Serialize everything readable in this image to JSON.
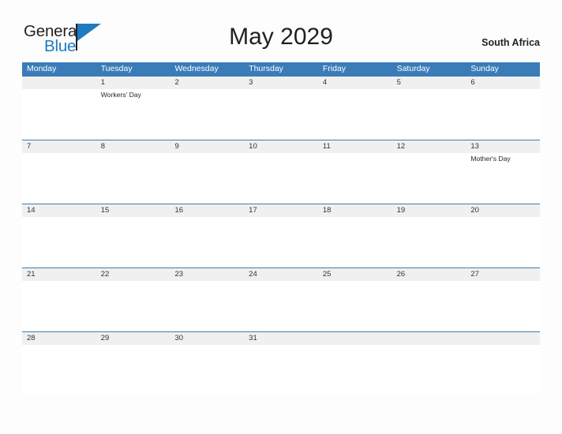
{
  "brand": {
    "name_part1": "General",
    "name_part2": "Blue"
  },
  "header": {
    "title": "May 2029",
    "country": "South Africa"
  },
  "calendar": {
    "weekdays": [
      "Monday",
      "Tuesday",
      "Wednesday",
      "Thursday",
      "Friday",
      "Saturday",
      "Sunday"
    ],
    "colors": {
      "header_blue": "#3a7cb8",
      "date_band_gray": "#f0f0f0",
      "brand_blue": "#1f7ac0",
      "page_background": "#fdfdfd",
      "text": "#231f20"
    },
    "weeks": [
      {
        "dates": [
          "",
          "1",
          "2",
          "3",
          "4",
          "5",
          "6"
        ],
        "events": [
          "",
          "Workers' Day",
          "",
          "",
          "",
          "",
          ""
        ]
      },
      {
        "dates": [
          "7",
          "8",
          "9",
          "10",
          "11",
          "12",
          "13"
        ],
        "events": [
          "",
          "",
          "",
          "",
          "",
          "",
          "Mother's Day"
        ]
      },
      {
        "dates": [
          "14",
          "15",
          "16",
          "17",
          "18",
          "19",
          "20"
        ],
        "events": [
          "",
          "",
          "",
          "",
          "",
          "",
          ""
        ]
      },
      {
        "dates": [
          "21",
          "22",
          "23",
          "24",
          "25",
          "26",
          "27"
        ],
        "events": [
          "",
          "",
          "",
          "",
          "",
          "",
          ""
        ]
      },
      {
        "dates": [
          "28",
          "29",
          "30",
          "31",
          "",
          "",
          ""
        ],
        "events": [
          "",
          "",
          "",
          "",
          "",
          "",
          ""
        ]
      }
    ]
  }
}
